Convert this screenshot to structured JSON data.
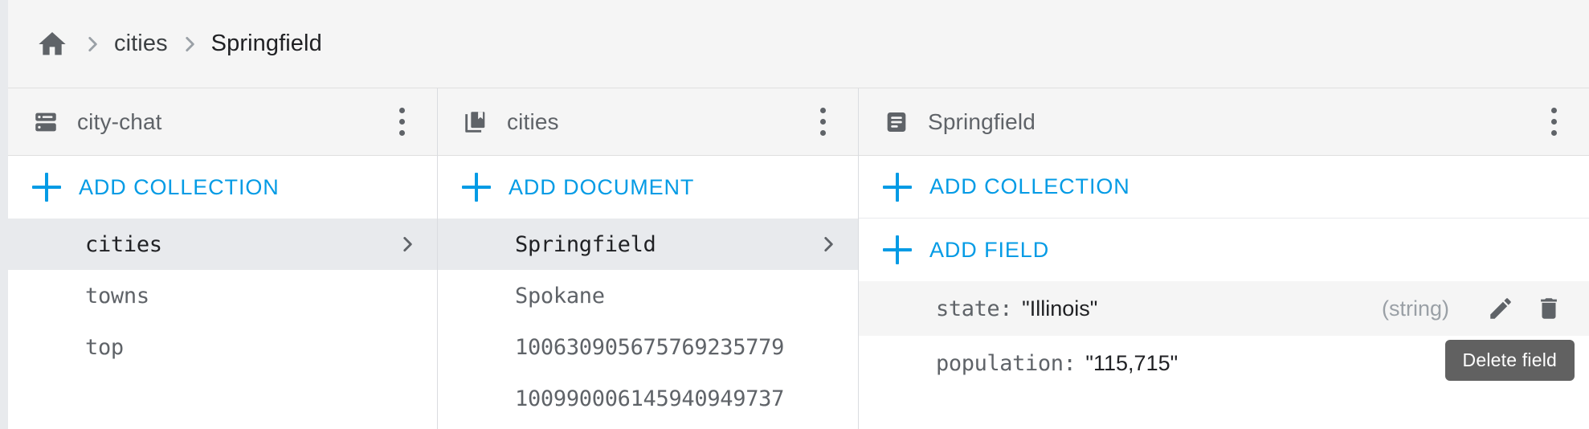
{
  "breadcrumb": {
    "home_icon": "home-icon",
    "separator": "chevron-right-icon",
    "items": [
      {
        "label": "cities",
        "current": false
      },
      {
        "label": "Springfield",
        "current": true
      }
    ]
  },
  "colors": {
    "accent": "#039be5",
    "header_bg": "#f5f5f5",
    "selected_bg": "#e8eaed",
    "text_primary": "#202124",
    "text_secondary": "#5f6368",
    "text_muted": "#9aa0a6",
    "tooltip_bg": "#616161"
  },
  "panels": [
    {
      "header": {
        "icon": "database-icon",
        "title": "city-chat",
        "menu_icon": "more-vert-icon"
      },
      "actions": [
        {
          "icon": "plus-icon",
          "label": "ADD COLLECTION"
        }
      ],
      "items": [
        {
          "label": "cities",
          "selected": true
        },
        {
          "label": "towns",
          "selected": false
        },
        {
          "label": "top",
          "selected": false
        }
      ]
    },
    {
      "header": {
        "icon": "collection-icon",
        "title": "cities",
        "menu_icon": "more-vert-icon"
      },
      "actions": [
        {
          "icon": "plus-icon",
          "label": "ADD DOCUMENT"
        }
      ],
      "items": [
        {
          "label": "Springfield",
          "selected": true
        },
        {
          "label": "Spokane",
          "selected": false
        },
        {
          "label": "100630905675769235779",
          "selected": false
        },
        {
          "label": "100990006145940949737",
          "selected": false
        }
      ]
    },
    {
      "header": {
        "icon": "document-icon",
        "title": "Springfield",
        "menu_icon": "more-vert-icon"
      },
      "actions": [
        {
          "icon": "plus-icon",
          "label": "ADD COLLECTION"
        },
        {
          "icon": "plus-icon",
          "label": "ADD FIELD"
        }
      ],
      "fields": [
        {
          "key": "state:",
          "value": "\"Illinois\"",
          "type": "(string)",
          "highlight": true,
          "edit_icon": "pencil-icon",
          "delete_icon": "trash-icon"
        },
        {
          "key": "population:",
          "value": "\"115,715\"",
          "type": "",
          "highlight": false,
          "edit_icon": "pencil-icon",
          "delete_icon": "trash-icon"
        }
      ]
    }
  ],
  "tooltip": {
    "text": "Delete field"
  }
}
